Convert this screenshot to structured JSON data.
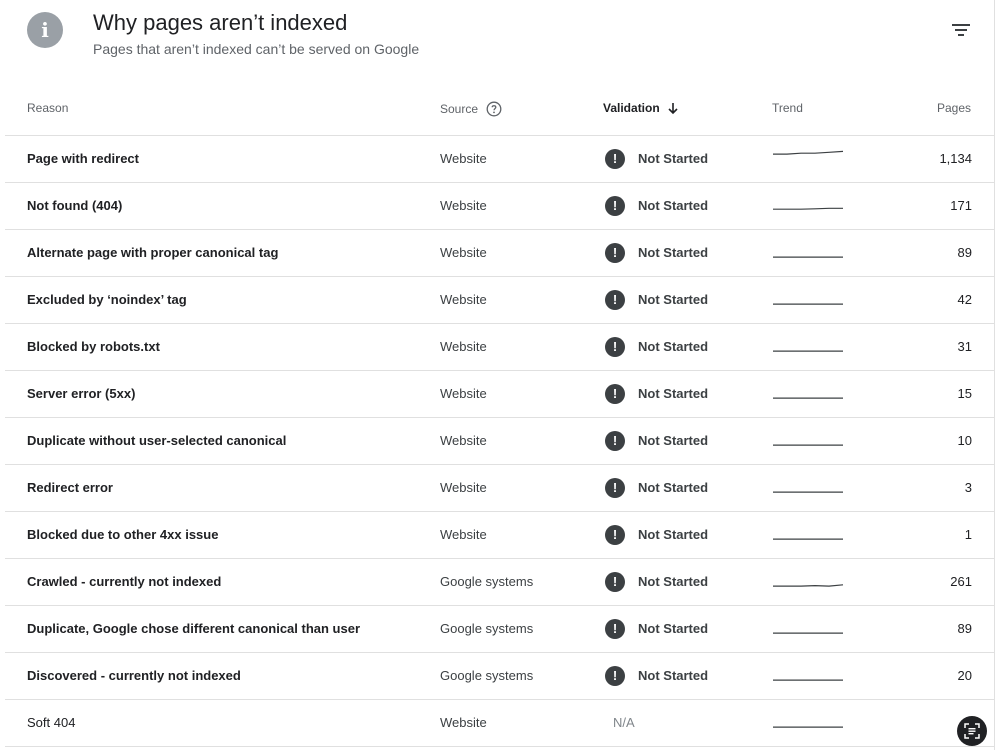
{
  "header": {
    "icon": "info-icon",
    "title": "Why pages aren’t indexed",
    "subtitle": "Pages that aren’t indexed can’t be served on Google",
    "filter_icon": "filter-icon"
  },
  "table": {
    "columns": {
      "reason": "Reason",
      "source": "Source",
      "validation": "Validation",
      "trend": "Trend",
      "pages": "Pages"
    },
    "sort": {
      "column": "validation",
      "direction": "descending"
    },
    "rows": [
      {
        "reason": "Page with redirect",
        "source": "Website",
        "validation": "Not Started",
        "pages": "1,134",
        "trend": [
          0.55,
          0.55,
          0.6,
          0.6,
          0.65,
          0.7
        ]
      },
      {
        "reason": "Not found (404)",
        "source": "Website",
        "validation": "Not Started",
        "pages": "171",
        "trend": [
          0.1,
          0.1,
          0.1,
          0.12,
          0.15,
          0.15
        ]
      },
      {
        "reason": "Alternate page with proper canonical tag",
        "source": "Website",
        "validation": "Not Started",
        "pages": "89",
        "trend": [
          0.05,
          0.05,
          0.05,
          0.05,
          0.05,
          0.05
        ]
      },
      {
        "reason": "Excluded by ‘noindex’ tag",
        "source": "Website",
        "validation": "Not Started",
        "pages": "42",
        "trend": [
          0.05,
          0.05,
          0.05,
          0.05,
          0.05,
          0.05
        ]
      },
      {
        "reason": "Blocked by robots.txt",
        "source": "Website",
        "validation": "Not Started",
        "pages": "31",
        "trend": [
          0.05,
          0.05,
          0.05,
          0.05,
          0.05,
          0.05
        ]
      },
      {
        "reason": "Server error (5xx)",
        "source": "Website",
        "validation": "Not Started",
        "pages": "15",
        "trend": [
          0.05,
          0.05,
          0.05,
          0.05,
          0.05,
          0.05
        ]
      },
      {
        "reason": "Duplicate without user-selected canonical",
        "source": "Website",
        "validation": "Not Started",
        "pages": "10",
        "trend": [
          0.05,
          0.05,
          0.05,
          0.05,
          0.05,
          0.05
        ]
      },
      {
        "reason": "Redirect error",
        "source": "Website",
        "validation": "Not Started",
        "pages": "3",
        "trend": [
          0.05,
          0.05,
          0.05,
          0.05,
          0.05,
          0.05
        ]
      },
      {
        "reason": "Blocked due to other 4xx issue",
        "source": "Website",
        "validation": "Not Started",
        "pages": "1",
        "trend": [
          0.05,
          0.05,
          0.05,
          0.05,
          0.05,
          0.05
        ]
      },
      {
        "reason": "Crawled - currently not indexed",
        "source": "Google systems",
        "validation": "Not Started",
        "pages": "261",
        "trend": [
          0.05,
          0.05,
          0.05,
          0.08,
          0.05,
          0.12
        ]
      },
      {
        "reason": "Duplicate, Google chose different canonical than user",
        "source": "Google systems",
        "validation": "Not Started",
        "pages": "89",
        "trend": [
          0.05,
          0.05,
          0.05,
          0.05,
          0.05,
          0.05
        ]
      },
      {
        "reason": "Discovered - currently not indexed",
        "source": "Google systems",
        "validation": "Not Started",
        "pages": "20",
        "trend": [
          0.05,
          0.05,
          0.05,
          0.05,
          0.05,
          0.05
        ]
      },
      {
        "reason": "Soft 404",
        "source": "Website",
        "validation": "N/A",
        "pages": "",
        "trend": [
          0.05,
          0.05,
          0.05,
          0.05,
          0.05,
          0.05
        ]
      }
    ]
  },
  "colors": {
    "status_icon": "#3c4043",
    "info_icon": "#9aa0a6",
    "divider": "#e0e0e0",
    "trend_line": "#3c4043"
  },
  "floating_button": {
    "icon": "lens-icon"
  }
}
